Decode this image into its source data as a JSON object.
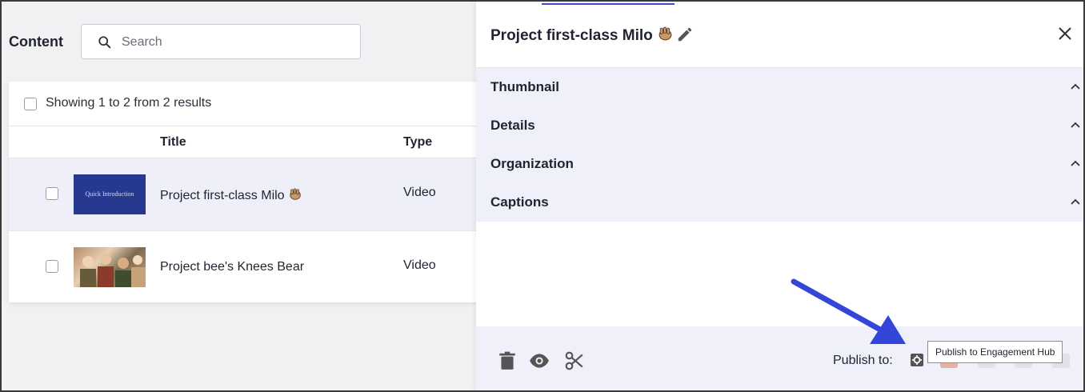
{
  "content": {
    "title": "Content",
    "search": {
      "placeholder": "Search",
      "value": ""
    },
    "showing_text": "Showing 1 to 2 from 2 results",
    "columns": {
      "title": "Title",
      "type": "Type"
    },
    "rows": [
      {
        "title": "Project first-class Milo",
        "type": "Video",
        "thumbnail_text": "Quick Introduction",
        "emoji": "waving-hand-emoji"
      },
      {
        "title": "Project bee's Knees Bear",
        "type": "Video"
      }
    ]
  },
  "panel": {
    "title": "Project first-class Milo",
    "sections": [
      "Thumbnail",
      "Details",
      "Organization",
      "Captions"
    ],
    "footer": {
      "publish_label": "Publish to:",
      "tooltip": "Publish to Engagement Hub"
    }
  },
  "colors": {
    "accent": "#3f4bc4",
    "panel_bg": "#eff0f9",
    "arrow": "#3346d8"
  },
  "icons": [
    "search-icon",
    "edit-icon",
    "close-icon",
    "chevron-up-icon",
    "trash-icon",
    "eye-icon",
    "scissors-icon",
    "engagement-hub-icon",
    "arrow-annotation"
  ]
}
